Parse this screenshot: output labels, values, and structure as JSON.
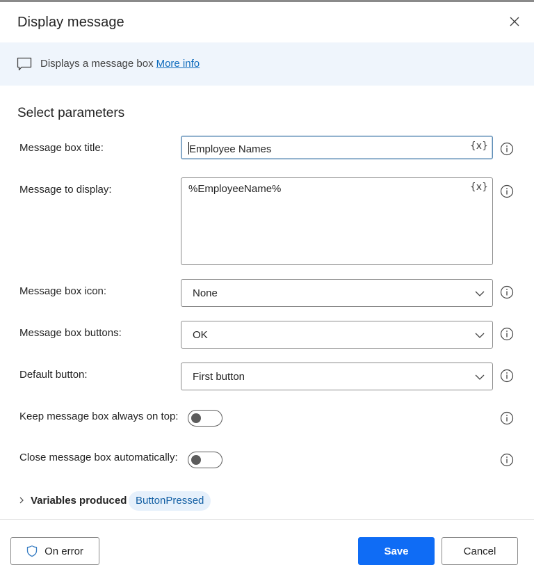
{
  "dialog": {
    "title": "Display message",
    "close_icon": "close-icon"
  },
  "banner": {
    "icon": "message-icon",
    "text": "Displays a message box",
    "link_label": "More info"
  },
  "section_title": "Select parameters",
  "parameters": {
    "message_box_title": {
      "label": "Message box title:",
      "value": "Employee Names",
      "variable_button": "{x}"
    },
    "message_to_display": {
      "label": "Message to display:",
      "value": "%EmployeeName%",
      "variable_button": "{x}"
    },
    "message_box_icon": {
      "label": "Message box icon:",
      "selected": "None"
    },
    "message_box_buttons": {
      "label": "Message box buttons:",
      "selected": "OK"
    },
    "default_button": {
      "label": "Default button:",
      "selected": "First button"
    },
    "keep_on_top": {
      "label": "Keep message box always on top:",
      "enabled": false
    },
    "close_automatically": {
      "label": "Close message box automatically:",
      "enabled": false
    }
  },
  "variables_produced": {
    "label": "Variables produced",
    "variables": [
      "ButtonPressed"
    ]
  },
  "footer": {
    "on_error_label": "On error",
    "save_label": "Save",
    "cancel_label": "Cancel"
  },
  "colors": {
    "primary": "#0f6cf5",
    "link": "#0f6cbd",
    "banner_bg": "#eff5fc",
    "chip_bg": "#e6f0fb",
    "chip_text": "#115ea3"
  }
}
